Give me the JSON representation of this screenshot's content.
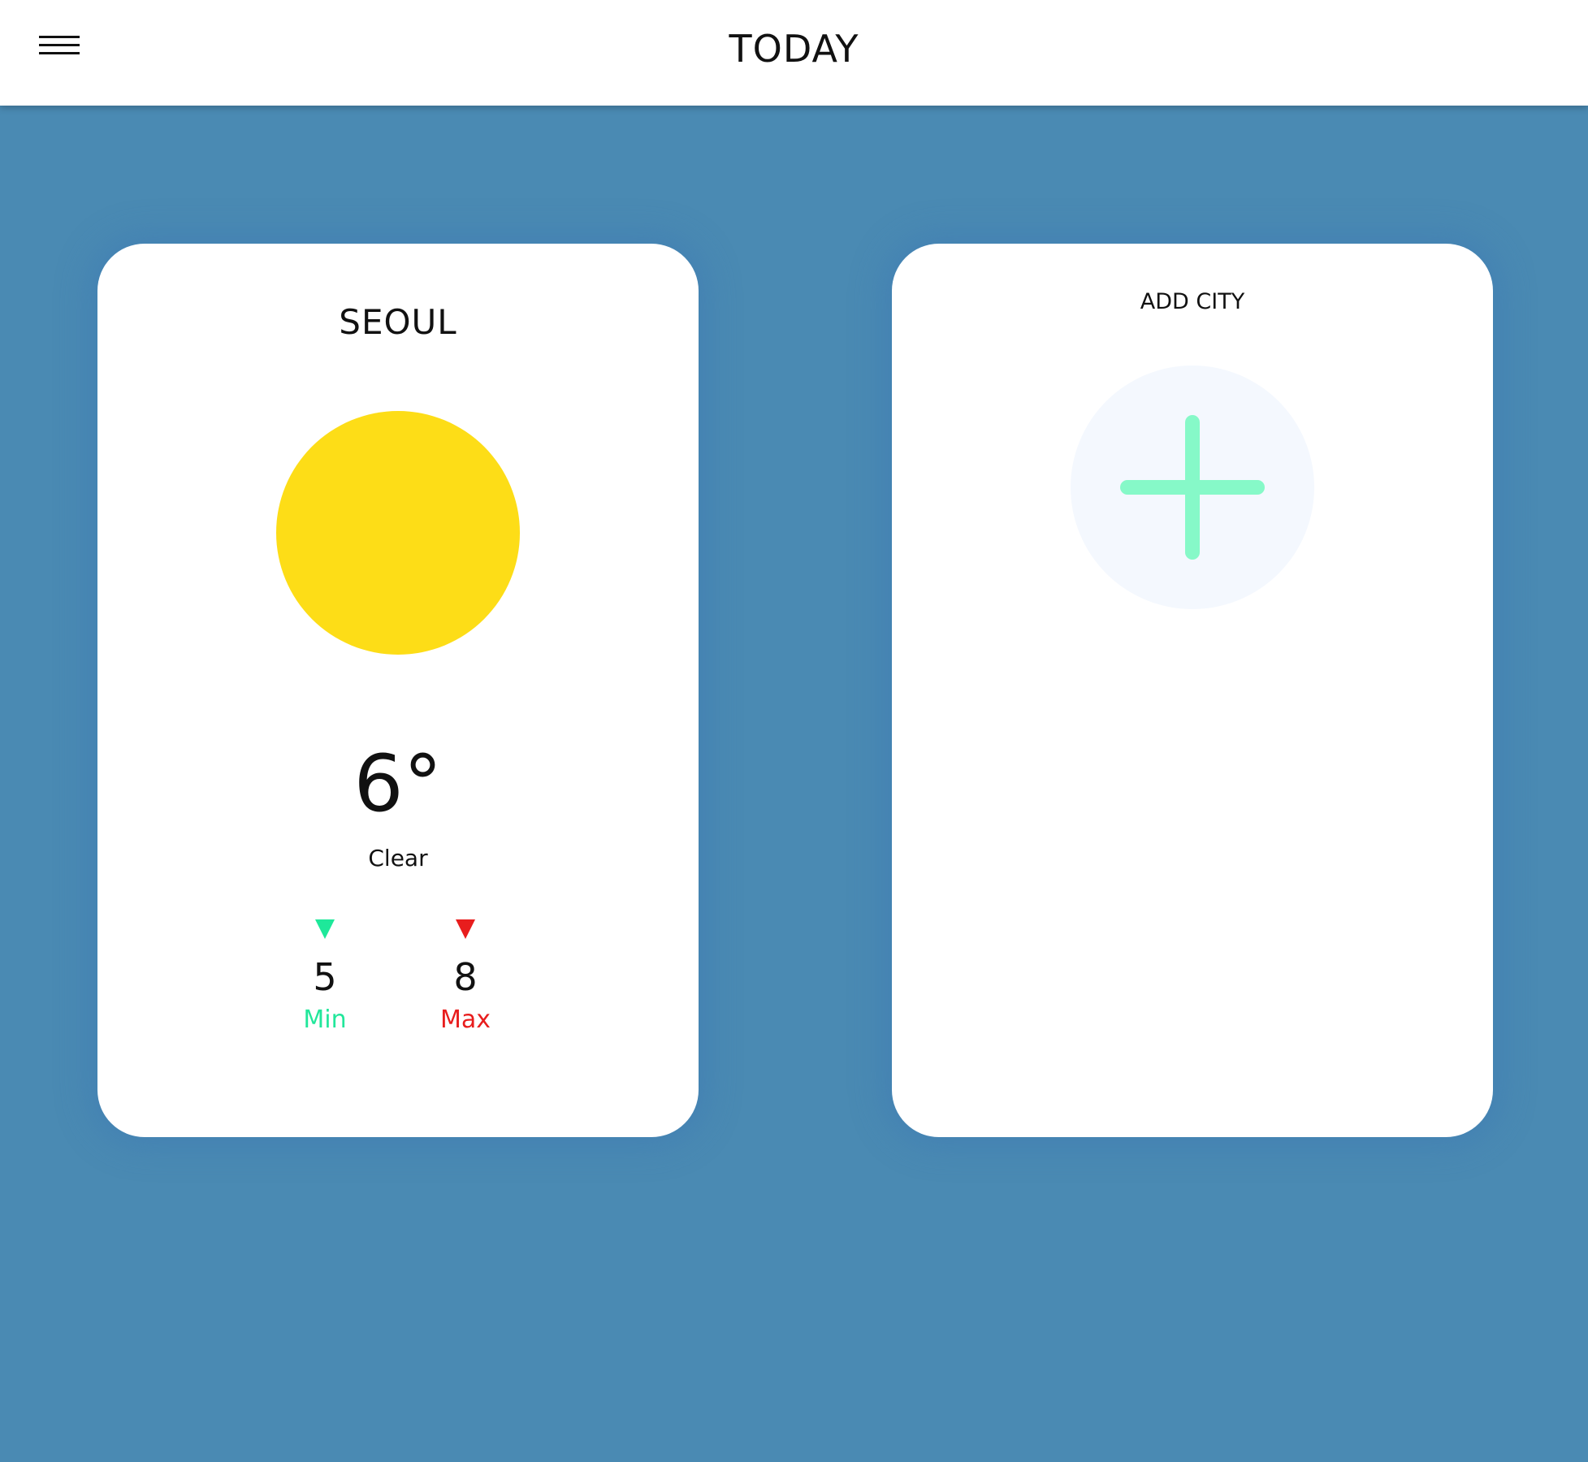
{
  "header": {
    "title": "TODAY",
    "menu_icon": "hamburger-menu-icon"
  },
  "weather_card": {
    "city": "SEOUL",
    "icon": "sun-icon",
    "temperature": "6°",
    "condition": "Clear",
    "min": {
      "value": "5",
      "label": "Min",
      "color": "#1ee89a"
    },
    "max": {
      "value": "8",
      "label": "Max",
      "color": "#e81d1d"
    }
  },
  "add_card": {
    "title": "ADD CITY",
    "icon": "plus-icon",
    "icon_color": "#86f9c8"
  },
  "colors": {
    "background": "#4a8ab3",
    "sun": "#fddd17"
  }
}
